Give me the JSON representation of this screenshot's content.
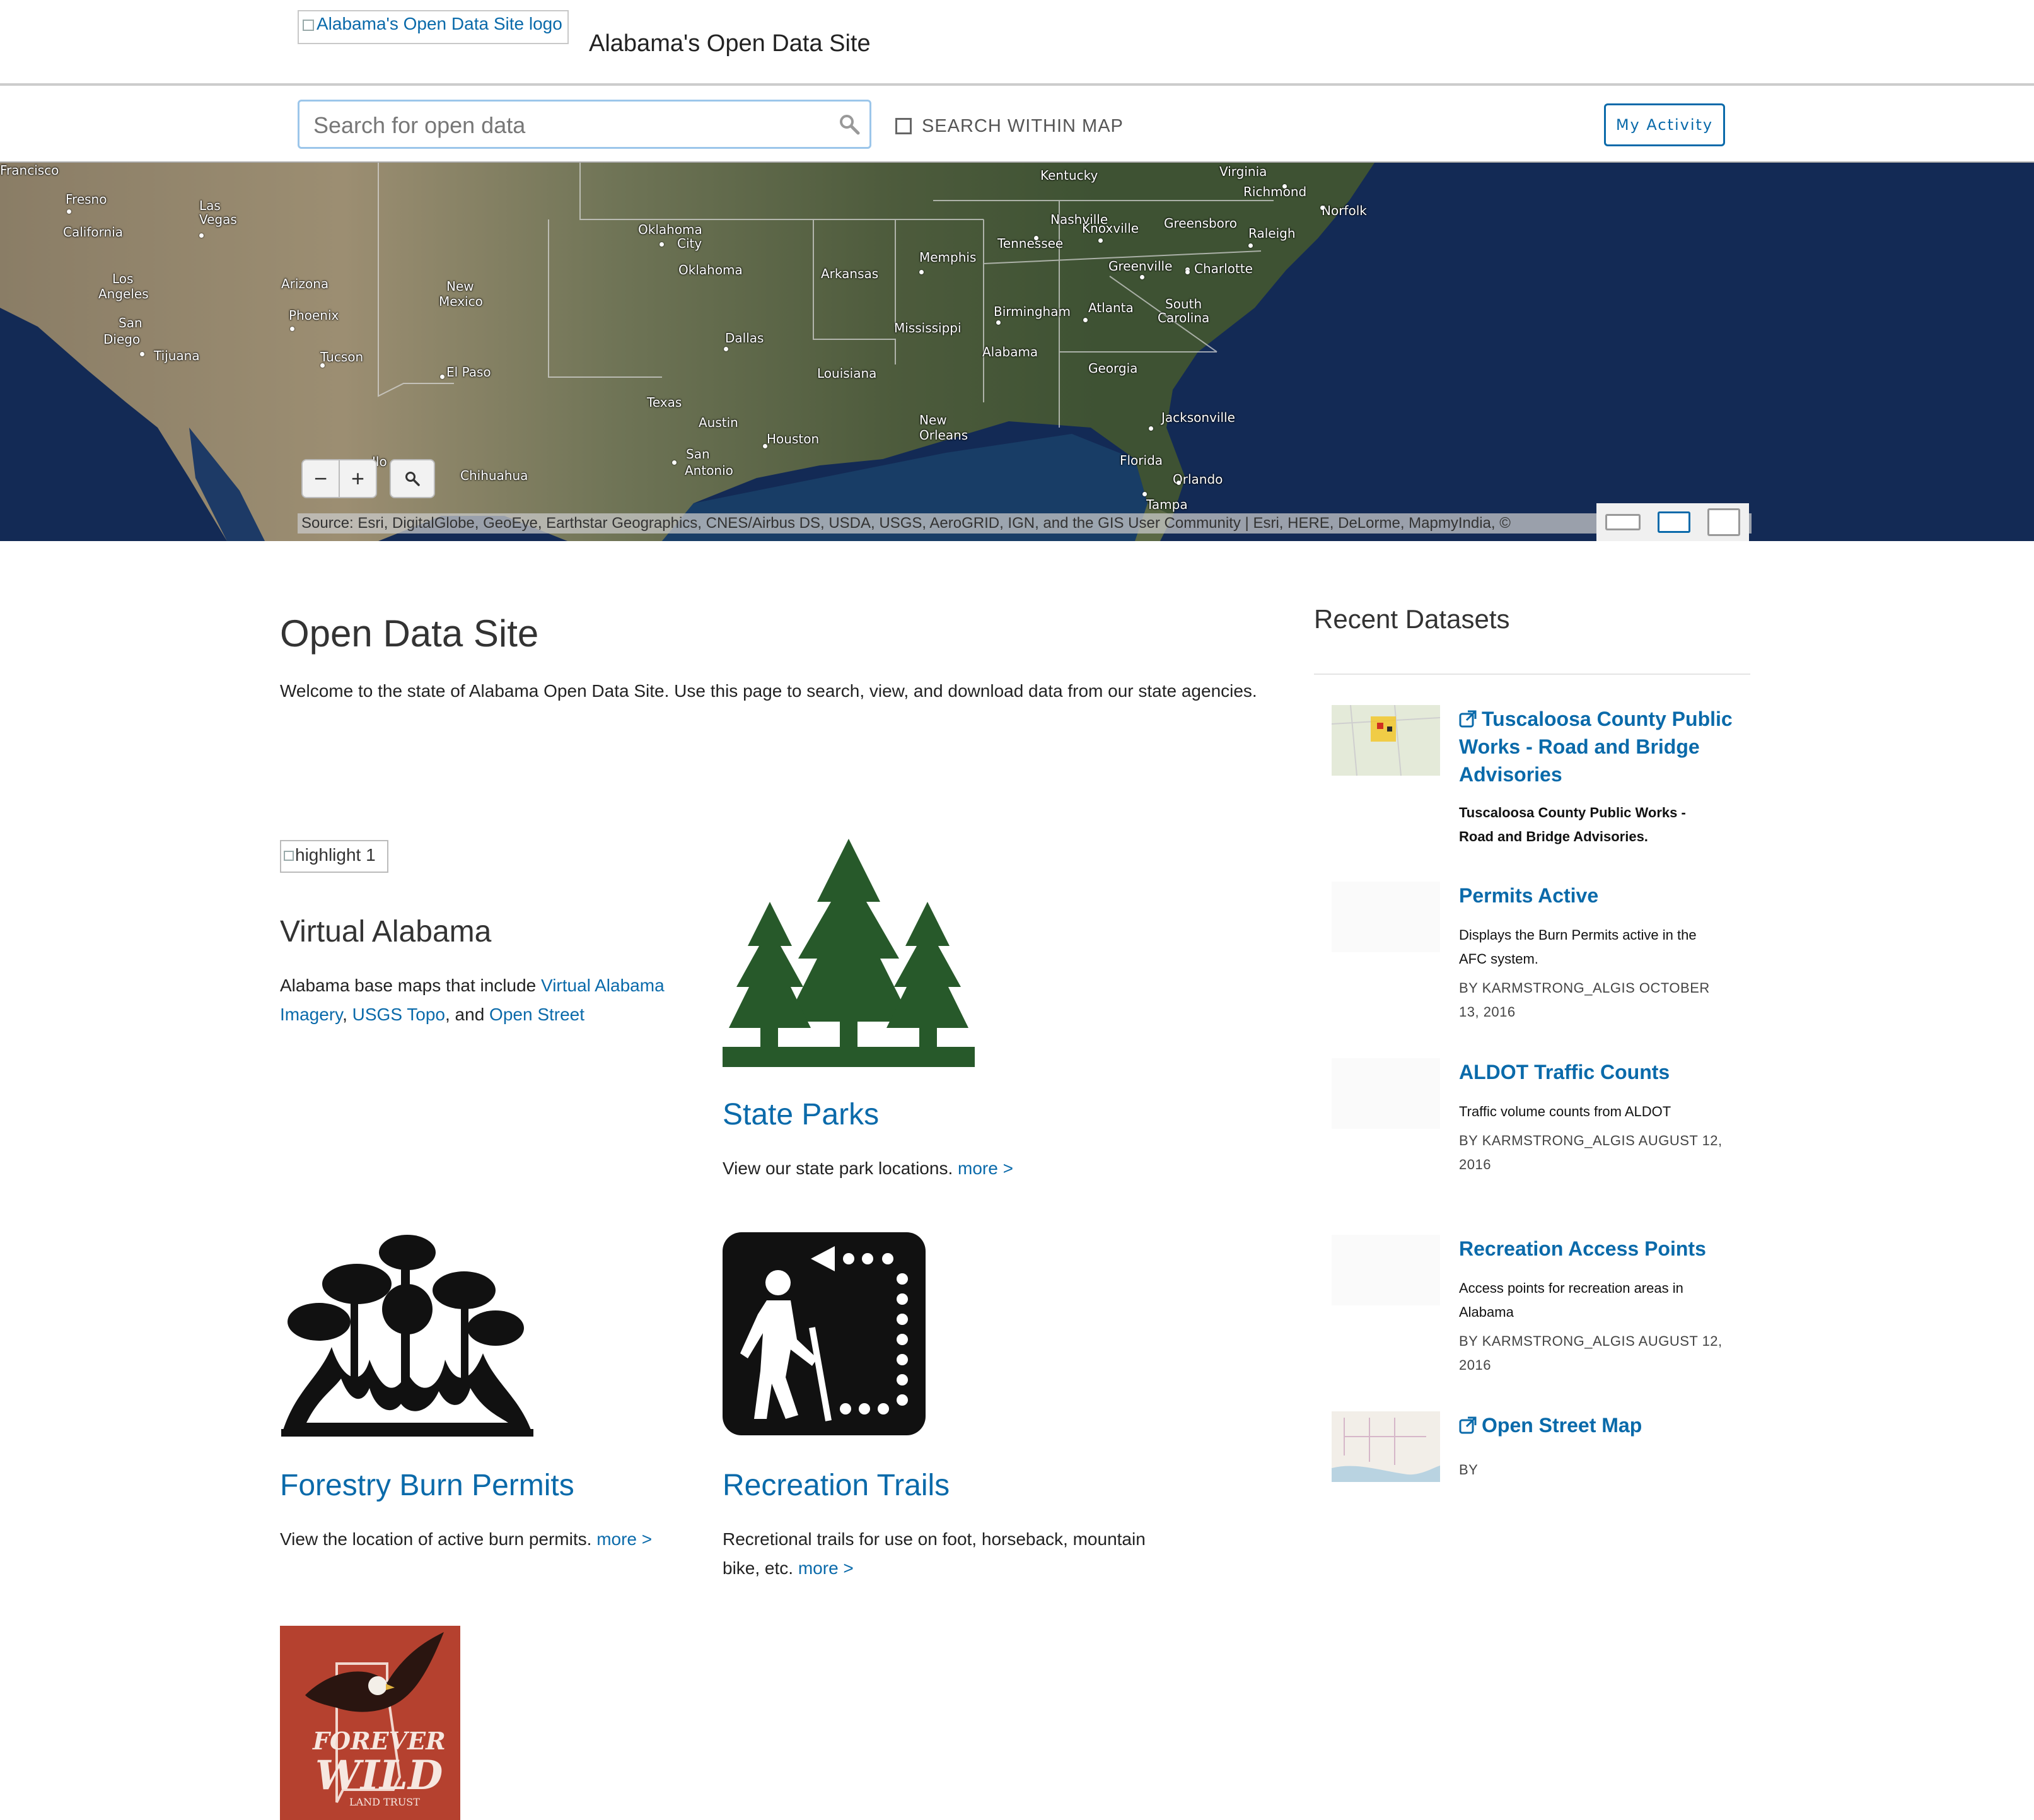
{
  "header": {
    "logo_alt": "Alabama's Open Data Site logo",
    "site_title": "Alabama's Open Data Site"
  },
  "search": {
    "placeholder": "Search for open data",
    "within_map_label": "SEARCH WITHIN MAP",
    "within_map_checked": false,
    "my_activity_label": "My Activity"
  },
  "map": {
    "labels": [
      {
        "text": "Francisco"
      },
      {
        "text": "Fresno"
      },
      {
        "text": "California"
      },
      {
        "text": "Las"
      },
      {
        "text": "Vegas"
      },
      {
        "text": "Los"
      },
      {
        "text": "Angeles"
      },
      {
        "text": "San"
      },
      {
        "text": "Diego"
      },
      {
        "text": "Tijuana"
      },
      {
        "text": "Arizona"
      },
      {
        "text": "Phoenix"
      },
      {
        "text": "Tucson"
      },
      {
        "text": "New"
      },
      {
        "text": "Mexico"
      },
      {
        "text": "El Paso"
      },
      {
        "text": "Chihuahua"
      },
      {
        "text": "Oklahoma"
      },
      {
        "text": "City"
      },
      {
        "text": "Oklahoma"
      },
      {
        "text": "Dallas"
      },
      {
        "text": "Texas"
      },
      {
        "text": "Austin"
      },
      {
        "text": "San"
      },
      {
        "text": "Antonio"
      },
      {
        "text": "Houston"
      },
      {
        "text": "Arkansas"
      },
      {
        "text": "Louisiana"
      },
      {
        "text": "New"
      },
      {
        "text": "Orleans"
      },
      {
        "text": "Memphis"
      },
      {
        "text": "Mississippi"
      },
      {
        "text": "Kentucky"
      },
      {
        "text": "Nashville"
      },
      {
        "text": "Tennessee"
      },
      {
        "text": "Knoxville"
      },
      {
        "text": "Birmingham"
      },
      {
        "text": "Alabama"
      },
      {
        "text": "Atlanta"
      },
      {
        "text": "Georgia"
      },
      {
        "text": "Greenville"
      },
      {
        "text": "Charlotte"
      },
      {
        "text": "Greensboro"
      },
      {
        "text": "Raleigh"
      },
      {
        "text": "Virginia"
      },
      {
        "text": "Richmond"
      },
      {
        "text": "Norfolk"
      },
      {
        "text": "South"
      },
      {
        "text": "Carolina"
      },
      {
        "text": "Jacksonville"
      },
      {
        "text": "Florida"
      },
      {
        "text": "Orlando"
      },
      {
        "text": "Tampa"
      },
      {
        "text": "Ilo"
      }
    ],
    "zoom_out": "−",
    "zoom_in": "+",
    "attribution": "Source: Esri, DigitalGlobe, GeoEye, Earthstar Geographics, CNES/Airbus DS, USDA, USGS, AeroGRID, IGN, and the GIS User Community |  Esri, HERE, DeLorme, MapmyIndia, ©"
  },
  "main": {
    "title": "Open Data Site",
    "welcome": "Welcome to the state of Alabama Open Data Site. Use this page to search, view, and download data from our state agencies.",
    "highlight_alt": "highlight 1",
    "cards": {
      "virtual": {
        "title": "Virtual Alabama",
        "text_before": "Alabama base maps that include ",
        "link1": "Virtual Alabama Imagery",
        "sep1": ", ",
        "link2": "USGS Topo",
        "sep2": ", and ",
        "link3": "Open Street"
      },
      "parks": {
        "title": "State Parks",
        "text": "View our state park locations. ",
        "more": "more >"
      },
      "burn": {
        "title": "Forestry Burn Permits",
        "text": "View the location of active burn permits. ",
        "more": "more >"
      },
      "trails": {
        "title": "Recreation Trails",
        "text": "Recretional trails for use on foot, horseback, mountain bike, etc. ",
        "more": "more >"
      },
      "forever_wild": {
        "logo_text_1": "FOREVER",
        "logo_text_2": "WILD",
        "logo_text_3": "LAND TRUST"
      }
    }
  },
  "recent": {
    "heading": "Recent Datasets",
    "items": [
      {
        "title": "Tuscaloosa County Public Works - Road and Bridge Advisories",
        "external": true,
        "desc": "Tuscaloosa County Public Works - Road and Bridge Advisories.",
        "meta": ""
      },
      {
        "title": "Permits Active",
        "external": false,
        "desc": "Displays the Burn Permits active in the AFC system.",
        "meta": "BY KARMSTRONG_ALGIS OCTOBER 13, 2016"
      },
      {
        "title": "ALDOT Traffic Counts",
        "external": false,
        "desc": "Traffic volume counts from ALDOT",
        "meta": "BY KARMSTRONG_ALGIS AUGUST 12, 2016"
      },
      {
        "title": "Recreation Access Points",
        "external": false,
        "desc": "Access points for recreation areas in Alabama",
        "meta": "BY KARMSTRONG_ALGIS AUGUST 12, 2016"
      },
      {
        "title": "Open Street Map",
        "external": true,
        "desc": "",
        "meta": "BY"
      }
    ]
  },
  "colors": {
    "link": "#0a6aaa",
    "tree_green": "#27592a",
    "forever_wild_red": "#b5412f"
  }
}
